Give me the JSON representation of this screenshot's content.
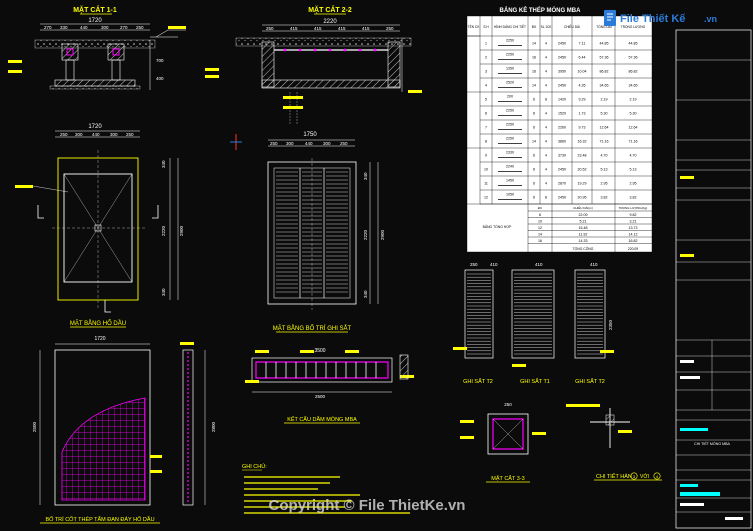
{
  "titles": {
    "sec11": "MẶT CẮT 1-1",
    "sec22": "MẶT CẮT 2-2",
    "table": "BẢNG KÊ THÉP MÓNG MBA",
    "plan_pit": "MẶT BẰNG HỐ DẦU",
    "plan_rebar": "MẶT BẰNG BỐ TRÍ GHI SẮT",
    "beam": "KẾT CẤU DẦM MÓNG MBA",
    "slab": "BỐ TRÍ CỐT THÉP TẤM ĐAN ĐÁY HỐ DẦU",
    "sec33": "MẶT CẮT 3-3",
    "weld": "CHI TIẾT HÀN",
    "weld_suffix": "VỚI",
    "weld_circle_a": "3",
    "weld_circle_b": "4",
    "grate_t2a": "GHI SẮT T2",
    "grate_t1": "GHI SẮT T1",
    "grate_t2b": "GHI SẮT T2",
    "notes": "GHI CHÚ:"
  },
  "dims": {
    "w1720": "1720",
    "sec11_parts": [
      "270",
      "330",
      "440",
      "300",
      "270",
      "250"
    ],
    "w2220": "2220",
    "sec22_parts": [
      "250",
      "415",
      "415",
      "415",
      "415",
      "250"
    ],
    "w1750": "1750",
    "top_parts": [
      "250",
      "300",
      "440",
      "300",
      "250"
    ],
    "v2220": "2220",
    "v340": "340",
    "v2900": "2900",
    "v400": "400",
    "g250": "250",
    "g410": "410",
    "g2350": "2350",
    "b3500": "3500",
    "b2500": "2500",
    "slab_w": "1720",
    "slab_h": "2500",
    "s_h": "2800",
    "s2_dim": "250"
  },
  "table": {
    "headers": [
      "TÊN CK",
      "S.H",
      "HÌNH DÁNG CHI TIẾT",
      "ĐK",
      "SL 1CK",
      "CHIỀU DÀI",
      "TỔNG DÀI",
      "TRỌNG LƯỢNG"
    ],
    "rows": [
      [
        "1",
        "2250",
        "14",
        "4",
        "2450",
        "7.11",
        "44.85"
      ],
      [
        "2",
        "2250",
        "16",
        "4",
        "2450",
        "6.44",
        "57.36"
      ],
      [
        "3",
        "1350",
        "16",
        "4",
        "3950",
        "10.04",
        "86.82"
      ],
      [
        "4",
        "2520",
        "14",
        "4",
        "2450",
        "4.26",
        "34.65"
      ],
      [
        "5",
        "200",
        "6",
        "8",
        "1420",
        "9.29",
        "2.19"
      ],
      [
        "6",
        "2250",
        "6",
        "4",
        "1520",
        "1.73",
        "5.30"
      ],
      [
        "7",
        "2250",
        "6",
        "4",
        "2260",
        "9.73",
        "12.64"
      ],
      [
        "8",
        "2250",
        "14",
        "4",
        "3860",
        "16.32",
        "71.16"
      ],
      [
        "9",
        "2330",
        "6",
        "4",
        "3730",
        "23.48",
        "4.70"
      ],
      [
        "10",
        "2240",
        "6",
        "4",
        "2450",
        "20.52",
        "5.13"
      ],
      [
        "11",
        "1450",
        "6",
        "4",
        "2870",
        "19.29",
        "2.95"
      ],
      [
        "12",
        "1050",
        "6",
        "8",
        "2450",
        "20.95",
        "3.82"
      ]
    ],
    "summary_title": "BẢNG TỔNG HỢP",
    "summary_headers": [
      "ĐK",
      "CHIỀU DÀI(m)",
      "TRỌNG LƯỢNG(Kg)"
    ],
    "summary_rows": [
      [
        "6",
        "22.09",
        "9.82"
      ],
      [
        "10",
        "5.21",
        "3.21"
      ],
      [
        "12",
        "15.48",
        "13.73"
      ],
      [
        "14",
        "11.92",
        "14.12"
      ],
      [
        "16",
        "14.33",
        "16.82"
      ]
    ],
    "total_label": "TỔNG CỘNG",
    "total_value": "220.09"
  },
  "logo": {
    "line1": "File Thiết Kế",
    "line2": ".vn"
  },
  "watermark": "Copyright © File ThietKe.vn",
  "title_block": {
    "project": "CHI TIẾT MÓNG MBA"
  },
  "colors": {
    "bg": "#0b0b0b",
    "yellow": "#ffff00",
    "white": "#ffffff",
    "magenta": "#ff00ff",
    "cyan": "#00ffff",
    "green": "#00ff00",
    "red": "#ff3333",
    "blue": "#2b7bd8",
    "orange": "#ffb020"
  }
}
